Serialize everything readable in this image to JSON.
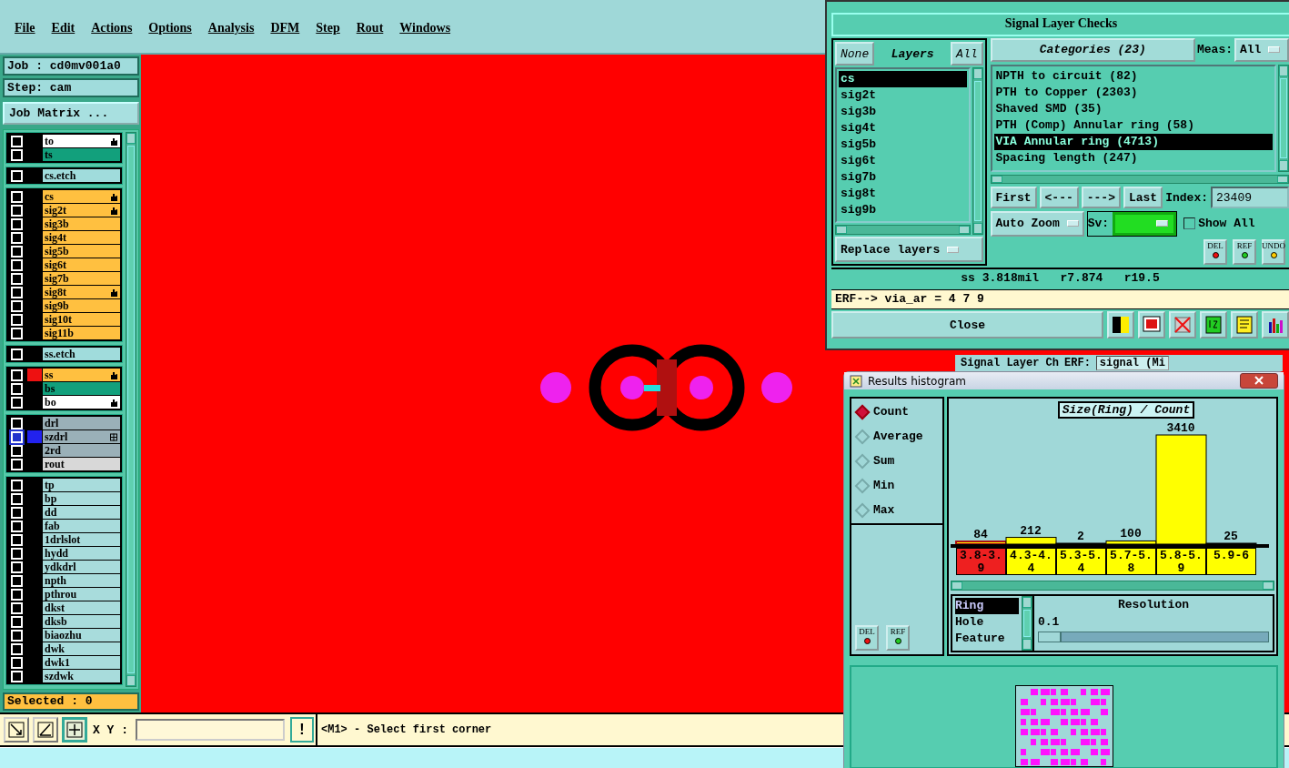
{
  "menu": [
    "File",
    "Edit",
    "Actions",
    "Options",
    "Analysis",
    "DFM",
    "Step",
    "Rout",
    "Windows"
  ],
  "job": {
    "job": "Job : cd0mv001a0",
    "step": "Step: cam",
    "matrix_button": "Job Matrix ..."
  },
  "layer_groups": [
    {
      "layers": [
        {
          "name": "to",
          "kind": "board",
          "pinned": true,
          "focused": false
        },
        {
          "name": "ts",
          "kind": "solder",
          "pinned": false,
          "focused": false
        }
      ]
    },
    {
      "layers": [
        {
          "name": "cs.etch",
          "kind": "etch",
          "pinned": false,
          "focused": false
        }
      ]
    },
    {
      "layers": [
        {
          "name": "cs",
          "kind": "signal",
          "pinned": true,
          "focused": false
        },
        {
          "name": "sig2t",
          "kind": "signal",
          "pinned": true,
          "focused": false
        },
        {
          "name": "sig3b",
          "kind": "signal",
          "pinned": false,
          "focused": false
        },
        {
          "name": "sig4t",
          "kind": "signal",
          "pinned": false,
          "focused": false
        },
        {
          "name": "sig5b",
          "kind": "signal",
          "pinned": false,
          "focused": false
        },
        {
          "name": "sig6t",
          "kind": "signal",
          "pinned": false,
          "focused": false
        },
        {
          "name": "sig7b",
          "kind": "signal",
          "pinned": false,
          "focused": false
        },
        {
          "name": "sig8t",
          "kind": "signal",
          "pinned": true,
          "focused": false
        },
        {
          "name": "sig9b",
          "kind": "signal",
          "pinned": false,
          "focused": false
        },
        {
          "name": "sig10t",
          "kind": "signal",
          "pinned": false,
          "focused": false
        },
        {
          "name": "sig11b",
          "kind": "signal",
          "pinned": false,
          "focused": false
        }
      ]
    },
    {
      "layers": [
        {
          "name": "ss.etch",
          "kind": "etch",
          "pinned": false,
          "focused": false
        }
      ]
    },
    {
      "layers": [
        {
          "name": "ss",
          "kind": "signal",
          "color": "#ee1111",
          "pinned": true,
          "focused": false
        },
        {
          "name": "bs",
          "kind": "solder",
          "pinned": false,
          "focused": false
        },
        {
          "name": "bo",
          "kind": "board",
          "pinned": true,
          "focused": false
        }
      ]
    },
    {
      "layers": [
        {
          "name": "drl",
          "kind": "drill",
          "pinned": false,
          "focused": false
        },
        {
          "name": "szdrl",
          "kind": "drill",
          "color": "#2222ee",
          "pinned": false,
          "grid": true,
          "focused": true
        },
        {
          "name": "2rd",
          "kind": "drill",
          "pinned": false,
          "focused": false
        },
        {
          "name": "rout",
          "kind": "rout",
          "pinned": false,
          "focused": false
        }
      ]
    },
    {
      "layers": [
        {
          "name": "tp",
          "kind": "doc",
          "pinned": false,
          "focused": false
        },
        {
          "name": "bp",
          "kind": "doc",
          "pinned": false,
          "focused": false
        },
        {
          "name": "dd",
          "kind": "doc",
          "pinned": false,
          "focused": false
        },
        {
          "name": "fab",
          "kind": "doc",
          "pinned": false,
          "focused": false
        },
        {
          "name": "1drlslot",
          "kind": "doc",
          "pinned": false,
          "focused": false
        },
        {
          "name": "hydd",
          "kind": "doc",
          "pinned": false,
          "focused": false
        },
        {
          "name": "ydkdrl",
          "kind": "doc",
          "pinned": false,
          "focused": false
        },
        {
          "name": "npth",
          "kind": "doc",
          "pinned": false,
          "focused": false
        },
        {
          "name": "pthrou",
          "kind": "doc",
          "pinned": false,
          "focused": false
        },
        {
          "name": "dkst",
          "kind": "doc",
          "pinned": false,
          "focused": false
        },
        {
          "name": "dksb",
          "kind": "doc",
          "pinned": false,
          "focused": false
        },
        {
          "name": "biaozhu",
          "kind": "doc",
          "pinned": false,
          "focused": false
        },
        {
          "name": "dwk",
          "kind": "doc",
          "pinned": false,
          "focused": false
        },
        {
          "name": "dwk1",
          "kind": "doc",
          "pinned": false,
          "focused": false
        },
        {
          "name": "szdwk",
          "kind": "doc",
          "pinned": false,
          "focused": false
        }
      ]
    }
  ],
  "selected_count": "Selected : 0",
  "status_bar": {
    "tools": [
      {
        "pressed": false
      },
      {
        "pressed": false
      },
      {
        "pressed": true
      }
    ],
    "xy_label": "X Y :",
    "alert_button": "!",
    "message": "<M1> - Select first corner"
  },
  "results_viewer": {
    "title": "Signal Layer Checks",
    "none_button": "None",
    "layers_label": "Layers",
    "all_button": "All",
    "layers": [
      {
        "name": "cs",
        "selected": true
      },
      {
        "name": "sig2t",
        "selected": false
      },
      {
        "name": "sig3b",
        "selected": false
      },
      {
        "name": "sig4t",
        "selected": false
      },
      {
        "name": "sig5b",
        "selected": false
      },
      {
        "name": "sig6t",
        "selected": false
      },
      {
        "name": "sig7b",
        "selected": false
      },
      {
        "name": "sig8t",
        "selected": false
      },
      {
        "name": "sig9b",
        "selected": false
      }
    ],
    "categories_button": "Categories (23)",
    "meas_label": "Meas:",
    "meas_value": "All",
    "categories": [
      {
        "label": "NPTH to circuit (82)",
        "selected": false
      },
      {
        "label": "PTH to Copper (2303)",
        "selected": false
      },
      {
        "label": "Shaved SMD (35)",
        "selected": false
      },
      {
        "label": "PTH (Comp) Annular ring (58)",
        "selected": false
      },
      {
        "label": "VIA Annular ring (4713)",
        "selected": true
      },
      {
        "label": "Spacing length (247)",
        "selected": false
      }
    ],
    "nav": [
      "First",
      "<---",
      "--->",
      "Last"
    ],
    "index_label": "Index:",
    "index_value": "23409",
    "zoom_dropdown": "Auto Zoom",
    "sv_label": "Sv:",
    "show_all": {
      "label": "Show All",
      "checked": false
    },
    "replace_dropdown": "Replace layers",
    "action_buttons": [
      {
        "label": "DEL",
        "kind": "del"
      },
      {
        "label": "REF",
        "kind": "ref"
      },
      {
        "label": "UNDO",
        "kind": "undo"
      }
    ],
    "measurement": "ss 3.818mil   r7.874   r19.5",
    "erf_line": "ERF--> via_ar = 4 7 9",
    "close_button": "Close"
  },
  "background_window": {
    "title": "Signal Layer Ch",
    "erf_label": "ERF:",
    "field_value": "signal (Mi"
  },
  "histogram": {
    "title": "Results histogram",
    "modes": [
      {
        "label": "Count",
        "selected": true
      },
      {
        "label": "Average",
        "selected": false
      },
      {
        "label": "Sum",
        "selected": false
      },
      {
        "label": "Min",
        "selected": false
      },
      {
        "label": "Max",
        "selected": false
      }
    ],
    "buttons": [
      {
        "label": "DEL",
        "kind": "del"
      },
      {
        "label": "REF",
        "kind": "ref"
      }
    ],
    "chart_title": "Size(Ring) / Count",
    "bins": [
      {
        "flagged": true
      },
      {
        "flagged": false
      },
      {
        "flagged": false
      },
      {
        "flagged": false
      },
      {
        "flagged": false
      },
      {
        "flagged": false
      }
    ],
    "chart_data": {
      "type": "bar",
      "categories": [
        "3.8-3.9",
        "4.3-4.4",
        "5.3-5.4",
        "5.7-5.8",
        "5.8-5.9",
        "5.9-6"
      ],
      "series": [
        {
          "color": "#ffff00",
          "values": [
            84,
            212,
            2,
            100,
            3410,
            25
          ]
        }
      ],
      "data_labels": true
    },
    "attributes": [
      {
        "label": "Ring",
        "selected": true
      },
      {
        "label": "Hole",
        "selected": false
      },
      {
        "label": "Feature",
        "selected": false
      }
    ],
    "resolution_label": "Resolution",
    "resolution_value": "0.1",
    "resolution_slider": {
      "level": 0.1
    }
  }
}
